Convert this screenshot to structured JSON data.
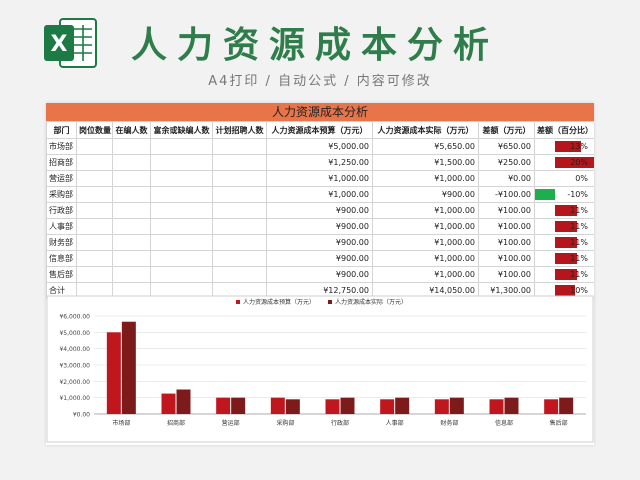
{
  "hero": {
    "title": "人力资源成本分析",
    "subtitle": "A4打印 / 自动公式 / 内容可修改",
    "logo_icon": "excel-logo-icon",
    "logo_letter": "X",
    "accent": "#2e7d4a"
  },
  "sheet": {
    "banner": "人力资源成本分析",
    "banner_color": "#e8744a",
    "headers": [
      "部门",
      "岗位数量",
      "在编人数",
      "富余或缺编人数",
      "计划招聘人数",
      "人力资源成本预算（万元）",
      "人力资源成本实际（万元）",
      "差额（万元）",
      "差额（百分比）"
    ],
    "rows": [
      {
        "dept": "市场部",
        "budget": "¥5,000.00",
        "actual": "¥5,650.00",
        "diff": "¥650.00",
        "pct": "13%",
        "pct_value": 13
      },
      {
        "dept": "招商部",
        "budget": "¥1,250.00",
        "actual": "¥1,500.00",
        "diff": "¥250.00",
        "pct": "20%",
        "pct_value": 20
      },
      {
        "dept": "营运部",
        "budget": "¥1,000.00",
        "actual": "¥1,000.00",
        "diff": "¥0.00",
        "pct": "0%",
        "pct_value": 0
      },
      {
        "dept": "采购部",
        "budget": "¥1,000.00",
        "actual": "¥900.00",
        "diff": "-¥100.00",
        "pct": "-10%",
        "pct_value": -10
      },
      {
        "dept": "行政部",
        "budget": "¥900.00",
        "actual": "¥1,000.00",
        "diff": "¥100.00",
        "pct": "11%",
        "pct_value": 11
      },
      {
        "dept": "人事部",
        "budget": "¥900.00",
        "actual": "¥1,000.00",
        "diff": "¥100.00",
        "pct": "11%",
        "pct_value": 11
      },
      {
        "dept": "财务部",
        "budget": "¥900.00",
        "actual": "¥1,000.00",
        "diff": "¥100.00",
        "pct": "11%",
        "pct_value": 11
      },
      {
        "dept": "信息部",
        "budget": "¥900.00",
        "actual": "¥1,000.00",
        "diff": "¥100.00",
        "pct": "11%",
        "pct_value": 11
      },
      {
        "dept": "售后部",
        "budget": "¥900.00",
        "actual": "¥1,000.00",
        "diff": "¥100.00",
        "pct": "11%",
        "pct_value": 11
      },
      {
        "dept": "合计",
        "budget": "¥12,750.00",
        "actual": "¥14,050.00",
        "diff": "¥1,300.00",
        "pct": "10%",
        "pct_value": 10
      }
    ],
    "pos_bar_color": "#b5161c",
    "neg_bar_color": "#1fae4f",
    "pct_scale_max": 20
  },
  "chart_data": {
    "type": "bar",
    "categories": [
      "市场部",
      "招商部",
      "营运部",
      "采购部",
      "行政部",
      "人事部",
      "财务部",
      "信息部",
      "售后部"
    ],
    "series": [
      {
        "name": "人力资源成本预算（万元）",
        "values": [
          5000,
          1250,
          1000,
          1000,
          900,
          900,
          900,
          900,
          900
        ],
        "color": "#c0171f"
      },
      {
        "name": "人力资源成本实际（万元）",
        "values": [
          5650,
          1500,
          1000,
          900,
          1000,
          1000,
          1000,
          1000,
          1000
        ],
        "color": "#7d1b1b"
      }
    ],
    "y_ticks": [
      "¥0.00",
      "¥1,000.00",
      "¥2,000.00",
      "¥3,000.00",
      "¥4,000.00",
      "¥5,000.00",
      "¥6,000.00"
    ],
    "ylim": [
      0,
      6000
    ],
    "legend": "top-center",
    "grid": true
  }
}
